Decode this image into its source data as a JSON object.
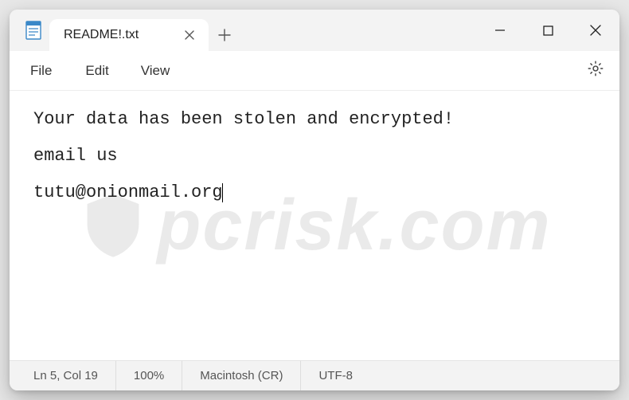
{
  "titlebar": {
    "tab_title": "README!.txt"
  },
  "menubar": {
    "file": "File",
    "edit": "Edit",
    "view": "View"
  },
  "document": {
    "line1": "Your data has been stolen and encrypted!",
    "line3": "email us",
    "line5": "tutu@onionmail.org"
  },
  "statusbar": {
    "position": "Ln 5, Col 19",
    "zoom": "100%",
    "line_endings": "Macintosh (CR)",
    "encoding": "UTF-8"
  },
  "watermark": "pcrisk.com"
}
